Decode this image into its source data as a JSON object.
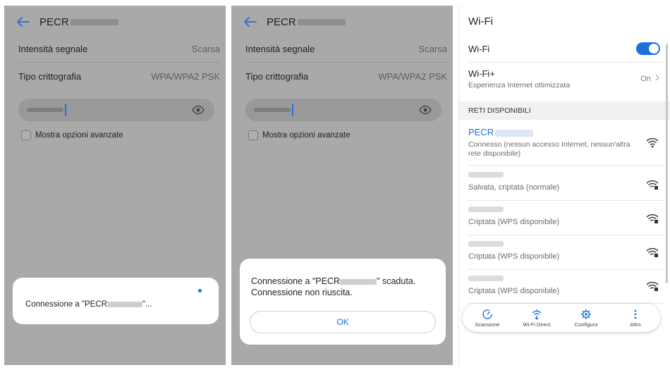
{
  "colors": {
    "accent": "#1e6fd9",
    "dim_overlay": "#a9a9a9"
  },
  "icons": [
    "back-arrow-icon",
    "eye-icon",
    "wifi-signal-icon",
    "wifi-lock-icon",
    "scan-icon",
    "wifi-direct-icon",
    "settings-icon",
    "more-icon",
    "chevron-right-icon"
  ],
  "panel1": {
    "title": "PECR",
    "signal_label": "Intensità segnale",
    "signal_value": "Scarsa",
    "crypto_label": "Tipo crittografia",
    "crypto_value": "WPA/WPA2 PSK",
    "advanced_label": "Mostra opzioni avanzate",
    "dialog_prefix": "Connessione a \"PECR",
    "dialog_suffix": "\"..."
  },
  "panel2": {
    "title": "PECR",
    "signal_label": "Intensità segnale",
    "signal_value": "Scarsa",
    "crypto_label": "Tipo crittografia",
    "crypto_value": "WPA/WPA2 PSK",
    "advanced_label": "Mostra opzioni avanzate",
    "dialog_prefix": "Connessione a \"PECR",
    "dialog_mid": "\" scaduta.",
    "dialog_line2": "Connessione non riuscita.",
    "ok_label": "OK"
  },
  "wifi": {
    "title": "Wi-Fi",
    "wifi_label": "Wi-Fi",
    "wifi_plus_label": "Wi-Fi+",
    "wifi_plus_sub": "Esperienza Internet ottimizzata",
    "wifi_plus_value": "On",
    "section_label": "RETI DISPONIBILI",
    "connected_name": "PECR",
    "connected_status": "Connesso (nessun accesso Internet, nessun'altra rete disponibile)",
    "networks": [
      {
        "status": "Salvata, criptata (normale)"
      },
      {
        "status": "Criptata (WPS disponibile)"
      },
      {
        "status": "Criptata (WPS disponibile)"
      },
      {
        "status": "Criptata (WPS disponibile)"
      }
    ],
    "bottom": {
      "scan": "Scansione",
      "wifi_direct": "Wi-Fi Direct",
      "configure": "Configura",
      "more": "Altro"
    }
  }
}
